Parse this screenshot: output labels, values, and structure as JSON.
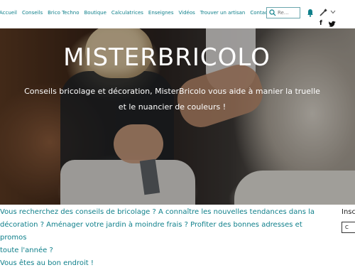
{
  "nav": {
    "items": [
      "Accueil",
      "Conseils",
      "Brico Techno",
      "Boutique",
      "Calculatrices",
      "Enseignes",
      "Vidéos",
      "Trouver un artisan",
      "Contact"
    ]
  },
  "search": {
    "placeholder": "Re..."
  },
  "icons": [
    "search-icon",
    "bell-icon",
    "brush-icon",
    "chevron-down-icon",
    "facebook-icon",
    "twitter-icon"
  ],
  "hero": {
    "title": "MISTERBRICOLO",
    "subtitle_line1": "Conseils bricolage et décoration, MisterBricolo vous aide à manier la truelle",
    "subtitle_line2": "et le nuancier de couleurs !"
  },
  "intro": {
    "line1": "Vous recherchez des conseils de bricolage ? A connaître les nouvelles tendances dans la",
    "line2": "décoration ? Aménager votre jardin à moindre frais ? Profiter des bonnes adresses et promos",
    "line3": "toute l'année ?",
    "line4": "Vous êtes au bon endroit !"
  },
  "sidebar": {
    "title": "Insc",
    "box_label": "C"
  },
  "colors": {
    "accent": "#0e7f8a",
    "background": "#ffffff"
  }
}
